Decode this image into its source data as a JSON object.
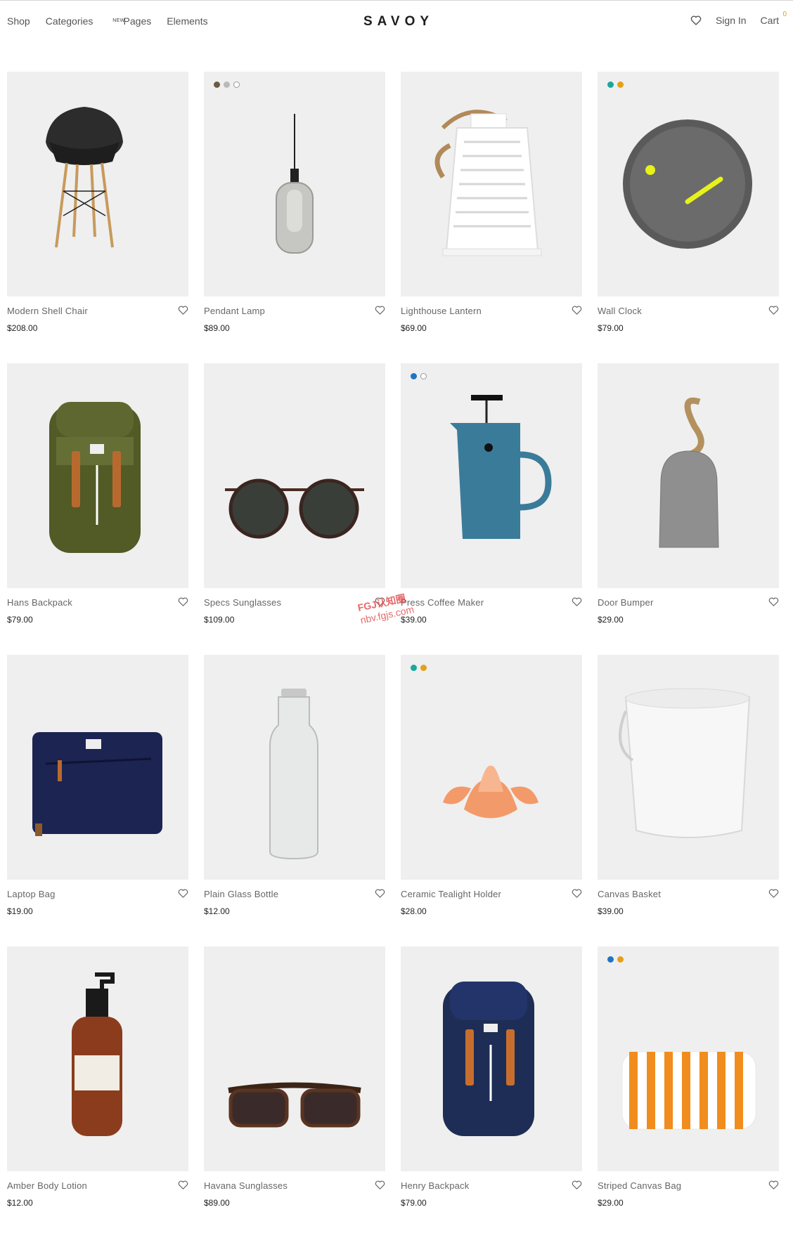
{
  "nav": {
    "shop": "Shop",
    "categories": "Categories",
    "categories_badge": "NEW",
    "pages": "Pages",
    "elements": "Elements",
    "logo": "SAVOY",
    "sign_in": "Sign In",
    "cart": "Cart",
    "cart_count": "0"
  },
  "watermark": {
    "line1": "FGJ认知圈",
    "line2": "nbv.fgjs.com"
  },
  "products": [
    {
      "title": "Modern Shell Chair",
      "price": "$208.00",
      "swatches": [],
      "icon": "chair"
    },
    {
      "title": "Pendant Lamp",
      "price": "$89.00",
      "swatches": [
        "#6b5b45",
        "#b9b9b9",
        "#ffffff"
      ],
      "icon": "lamp"
    },
    {
      "title": "Lighthouse Lantern",
      "price": "$69.00",
      "swatches": [],
      "icon": "lantern"
    },
    {
      "title": "Wall Clock",
      "price": "$79.00",
      "swatches": [
        "#1aa79c",
        "#e3a119"
      ],
      "icon": "clock"
    },
    {
      "title": "Hans Backpack",
      "price": "$79.00",
      "swatches": [],
      "icon": "backpack-green"
    },
    {
      "title": "Specs Sunglasses",
      "price": "$109.00",
      "swatches": [],
      "icon": "sunglasses-round"
    },
    {
      "title": "Press Coffee Maker",
      "price": "$39.00",
      "swatches": [
        "#1f74c4",
        "#ffffff"
      ],
      "icon": "coffee-press"
    },
    {
      "title": "Door Bumper",
      "price": "$29.00",
      "swatches": [],
      "icon": "door-bumper"
    },
    {
      "title": "Laptop Bag",
      "price": "$19.00",
      "swatches": [],
      "icon": "laptop-bag"
    },
    {
      "title": "Plain Glass Bottle",
      "price": "$12.00",
      "swatches": [],
      "icon": "bottle"
    },
    {
      "title": "Ceramic Tealight Holder",
      "price": "$28.00",
      "swatches": [
        "#1aa79c",
        "#e3a119"
      ],
      "icon": "tealight"
    },
    {
      "title": "Canvas Basket",
      "price": "$39.00",
      "swatches": [],
      "icon": "basket"
    },
    {
      "title": "Amber Body Lotion",
      "price": "$12.00",
      "swatches": [],
      "icon": "lotion"
    },
    {
      "title": "Havana Sunglasses",
      "price": "$89.00",
      "swatches": [],
      "icon": "sunglasses-square"
    },
    {
      "title": "Henry Backpack",
      "price": "$79.00",
      "swatches": [],
      "icon": "backpack-navy"
    },
    {
      "title": "Striped Canvas Bag",
      "price": "$29.00",
      "swatches": [
        "#1f74c4",
        "#e3a119"
      ],
      "icon": "striped-bag"
    }
  ]
}
